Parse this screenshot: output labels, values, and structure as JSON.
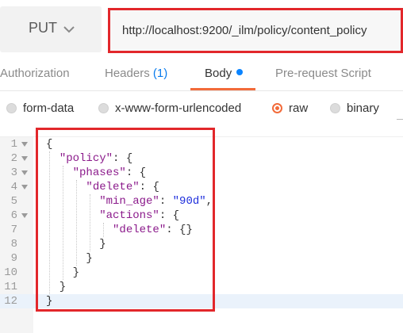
{
  "request": {
    "method": "PUT",
    "url": "http://localhost:9200/_ilm/policy/content_policy"
  },
  "tabs": [
    {
      "label": "Authorization"
    },
    {
      "label": "Headers",
      "count": "(1)"
    },
    {
      "label": "Body",
      "active": true,
      "indicator": "blue-dot"
    },
    {
      "label": "Pre-request Script"
    }
  ],
  "body_types": [
    {
      "label": "form-data",
      "selected": false
    },
    {
      "label": "x-www-form-urlencoded",
      "selected": false
    },
    {
      "label": "raw",
      "selected": true
    },
    {
      "label": "binary",
      "selected": false
    }
  ],
  "editor": {
    "active_line": 12,
    "lines": [
      {
        "n": "1",
        "text": "{"
      },
      {
        "n": "2",
        "text": "  \"policy\": {"
      },
      {
        "n": "3",
        "text": "    \"phases\": {"
      },
      {
        "n": "4",
        "text": "      \"delete\": {"
      },
      {
        "n": "5",
        "text": "        \"min_age\": \"90d\","
      },
      {
        "n": "6",
        "text": "        \"actions\": {"
      },
      {
        "n": "7",
        "text": "          \"delete\": {}"
      },
      {
        "n": "8",
        "text": "        }"
      },
      {
        "n": "9",
        "text": "      }"
      },
      {
        "n": "10",
        "text": "    }"
      },
      {
        "n": "11",
        "text": "  }"
      },
      {
        "n": "12",
        "text": "}"
      }
    ]
  },
  "colors": {
    "highlight_outline": "#e2272b",
    "active_tab": "#f26b3a",
    "json_key": "#8b1a8b",
    "json_string": "#1f2fdc"
  },
  "icons": {
    "method_dropdown": "chevron-down-icon",
    "fold": "caret-down-icon"
  }
}
